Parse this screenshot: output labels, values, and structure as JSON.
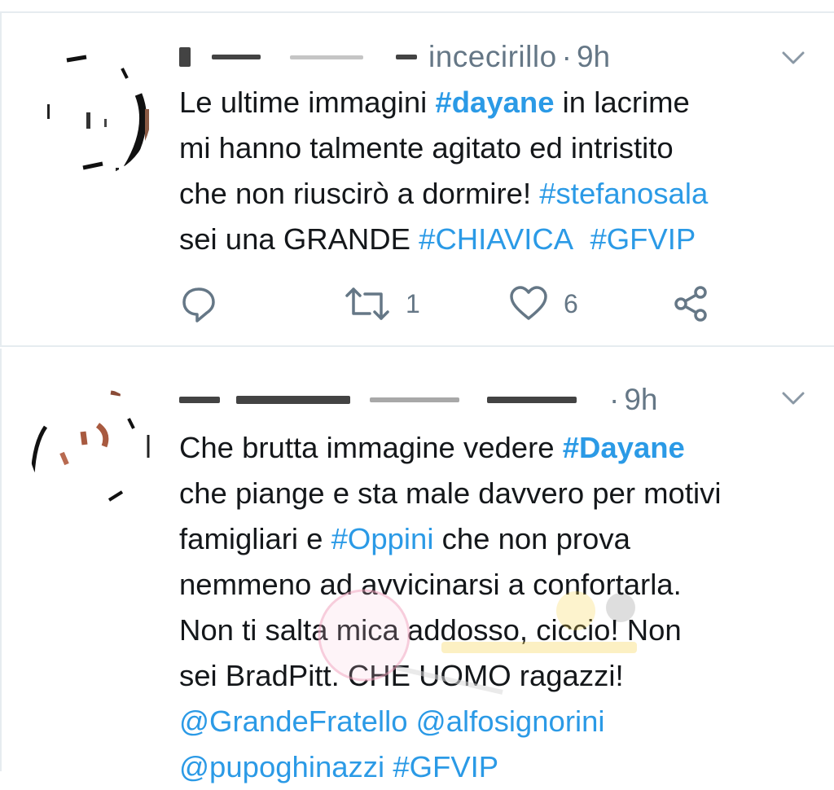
{
  "tweets": [
    {
      "handle_visible": "incecirillo",
      "separator": "·",
      "time": "9h",
      "body": {
        "line1_pre": "Le ultime immagini ",
        "tag1": "#dayane",
        "line1_post": " in lacrime",
        "line2": "mi hanno talmente agitato ed intristito",
        "line3_pre": "che non riuscirò a dormire! ",
        "tag2": "#stefanosala",
        "line4_pre": "sei una GRANDE ",
        "tag3": "#CHIAVICA",
        "tag4": "#GFVIP"
      },
      "actions": {
        "reply_icon": "reply-icon",
        "retweet_icon": "retweet-icon",
        "retweet_count": "1",
        "like_icon": "heart-icon",
        "like_count": "6",
        "share_icon": "share-icon"
      }
    },
    {
      "separator": "·",
      "time": "9h",
      "body": {
        "line1_pre": "Che brutta immagine vedere ",
        "tag1": "#Dayane",
        "line2": "che piange e sta male davvero per motivi",
        "line3_pre": "famigliari e ",
        "tag2": "#Oppini",
        "line3_post": " che non prova",
        "line4": "nemmeno ad avvicinarsi a confortarla.",
        "line5": "Non ti salta mica addosso, ciccio! Non",
        "line6": "sei BradPitt. CHE UOMO ragazzi!",
        "mention1": "@GrandeFratello",
        "mention2": "@alfosignorini",
        "mention3": "@pupoghinazzi",
        "tag3": "#GFVIP"
      }
    }
  ],
  "colors": {
    "link": "#2b9ae6",
    "meta": "#657786",
    "text": "#14171a",
    "divider": "#e6ecf0"
  }
}
